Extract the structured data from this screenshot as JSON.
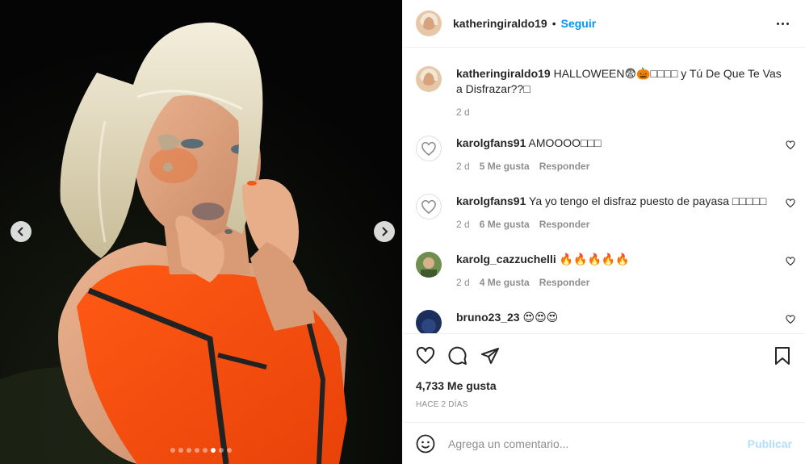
{
  "post": {
    "username": "katheringiraldo19",
    "follow_label": "Seguir",
    "separator": "•",
    "caption_text": "HALLOWEEN😨🎃□□□□ y Tú De Que Te Vas a Disfrazar??□",
    "caption_age": "2 d",
    "carousel": {
      "total": 8,
      "active_index": 5
    }
  },
  "comments": [
    {
      "username": "karolgfans91",
      "text": "AMOOOO□□□",
      "age": "2 d",
      "likes": "5 Me gusta",
      "reply": "Responder",
      "avatar": "heart-outline"
    },
    {
      "username": "karolgfans91",
      "text": "Ya yo tengo el disfraz puesto de payasa □□□□□",
      "age": "2 d",
      "likes": "6 Me gusta",
      "reply": "Responder",
      "avatar": "heart-outline"
    },
    {
      "username": "karolg_cazzuchelli",
      "text": "🔥🔥🔥🔥🔥",
      "age": "2 d",
      "likes": "4 Me gusta",
      "reply": "Responder",
      "avatar": "photo"
    },
    {
      "username": "bruno23_23",
      "text": "😍😍😍",
      "avatar": "photo"
    }
  ],
  "stats": {
    "likes": "4,733 Me gusta",
    "age": "HACE 2 DÍAS"
  },
  "add_comment": {
    "placeholder": "Agrega un comentario...",
    "publish_label": "Publicar"
  },
  "colors": {
    "accent": "#0095f6",
    "publish_disabled": "#b2dffc",
    "muted_text": "#8e8e8e",
    "border": "#efefef"
  },
  "icons": [
    "chevron-left-icon",
    "chevron-right-icon",
    "more-icon",
    "heart-icon",
    "comment-icon",
    "share-icon",
    "bookmark-icon",
    "emoji-icon"
  ]
}
